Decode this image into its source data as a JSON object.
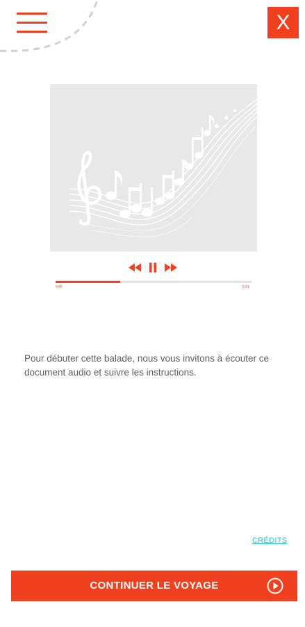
{
  "header": {
    "menu_icon": "hamburger-icon",
    "close_label": "X"
  },
  "player": {
    "image": "music-notes-illustration",
    "rewind_icon": "rewind-icon",
    "pause_icon": "pause-icon",
    "forward_icon": "fast-forward-icon",
    "progress_fraction": 0.33,
    "time_current": "0:45",
    "time_total": "5:31"
  },
  "content": {
    "intro_text": "Pour débuter cette balade, nous vous invitons à écouter ce document audio et suivre les instructions."
  },
  "footer": {
    "credits_label": "CRÉDITS",
    "continue_label": "CONTINUER LE VOYAGE",
    "continue_icon": "play-circle-icon"
  },
  "colors": {
    "accent": "#f0401f",
    "link": "#2bbcc8",
    "text": "#606060",
    "image_bg": "#e8e8e8"
  }
}
